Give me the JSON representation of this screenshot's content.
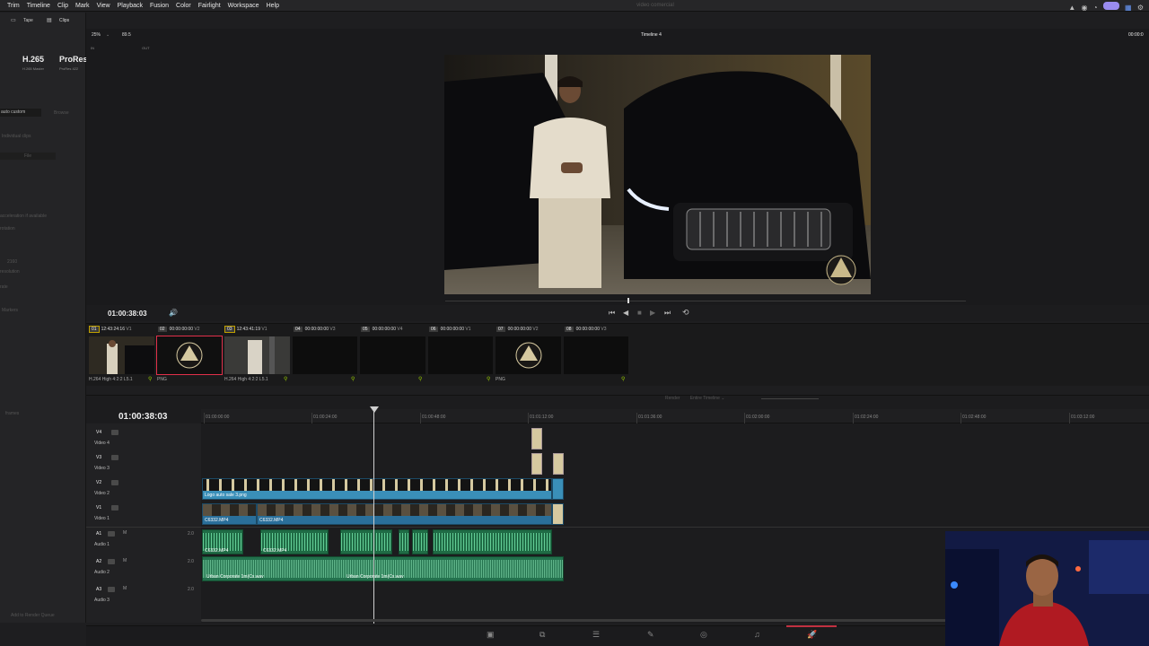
{
  "menu": [
    "Trim",
    "Timeline",
    "Clip",
    "Mark",
    "View",
    "Playback",
    "Fusion",
    "Color",
    "Fairlight",
    "Workspace",
    "Help"
  ],
  "project_title": "video comercial",
  "render": {
    "tabs": [
      "Tape",
      "Clips"
    ],
    "format_1": "H.265",
    "format_1_sub": "H.265 Master",
    "format_2": "ProRes",
    "format_2_sub": "ProRes 422",
    "preset_field": "auto custom",
    "browse_label": "Browse",
    "individual_clips": "Individual clips",
    "file_label": "File",
    "acceleration": "acceleration if available",
    "rotation": "rotation",
    "resolution": "2160",
    "resolution_label": "resolution",
    "rate_label": "rate",
    "markers_label": "Markers",
    "frames_label": "frames",
    "add_queue": "Add to Render Queue"
  },
  "viewer": {
    "zoom": "25%",
    "zoom_value": "89.5",
    "in_label": "IN",
    "out_label": "OUT",
    "timeline_name": "Timeline 4",
    "right_timecode": "00:00:0",
    "timecode": "01:00:38:03"
  },
  "clips": [
    {
      "num": "01",
      "tc": "12:43:24:16",
      "track": "V1",
      "codec": "H.264 High 4:2:2 L5.1"
    },
    {
      "num": "02",
      "tc": "00:00:00:00",
      "track": "V2",
      "codec": "PNG"
    },
    {
      "num": "03",
      "tc": "12:43:41:19",
      "track": "V1",
      "codec": "H.264 High 4:2:2 L5.1"
    },
    {
      "num": "04",
      "tc": "00:00:00:00",
      "track": "V3",
      "codec": ""
    },
    {
      "num": "05",
      "tc": "00:00:00:00",
      "track": "V4",
      "codec": ""
    },
    {
      "num": "06",
      "tc": "00:00:00:00",
      "track": "V1",
      "codec": ""
    },
    {
      "num": "07",
      "tc": "00:00:00:00",
      "track": "V2",
      "codec": "PNG"
    },
    {
      "num": "08",
      "tc": "00:00:00:00",
      "track": "V3",
      "codec": ""
    }
  ],
  "timeline": {
    "timecode": "01:00:38:03",
    "render_label": "Render",
    "entire_timeline": "Entire Timeline",
    "ruler": [
      "01:00:00:00",
      "01:00:24:00",
      "01:00:48:00",
      "01:01:12:00",
      "01:01:36:00",
      "01:02:00:00",
      "01:02:24:00",
      "01:02:48:00",
      "01:03:12:00"
    ],
    "tracks": [
      {
        "code": "V4",
        "name": "Video 4"
      },
      {
        "code": "V3",
        "name": "Video 3"
      },
      {
        "code": "V2",
        "name": "Video 2"
      },
      {
        "code": "V1",
        "name": "Video 1"
      },
      {
        "code": "A1",
        "name": "Audio 1",
        "channels": "2.0"
      },
      {
        "code": "A2",
        "name": "Audio 2",
        "channels": "2.0"
      },
      {
        "code": "A3",
        "name": "Audio 3",
        "channels": "2.0"
      }
    ],
    "clip_logo": "Logo auto sale 3.png",
    "clip_v1a": "C6332.MP4",
    "clip_v1b": "C6332.MP4",
    "clip_a1a": "C6332.MP4",
    "clip_a1b": "C6332.MP4",
    "clip_a2a": "Urban Corporate 1m(Cx.wav",
    "clip_a2b": "Urban Corporate 1m(Cx.wav"
  },
  "colors": {
    "accent": "#9a8cf0",
    "video_clip": "#2a6f9a",
    "audio_clip": "#1f6b45",
    "logo_clip": "#3a8fb8"
  }
}
